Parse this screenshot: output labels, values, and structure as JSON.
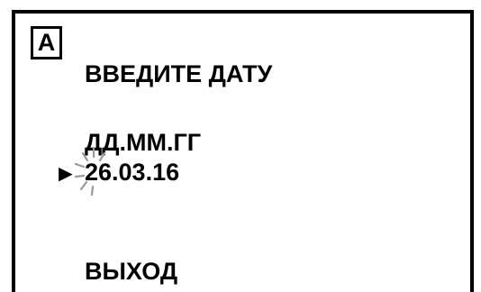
{
  "mode_badge": "A",
  "title": "ВВЕДИТЕ ДАТУ",
  "date_format": "ДД.ММ.ГГ",
  "date_value": "26.03.16",
  "cursor_symbol": "►",
  "exit_label": "ВЫХОД",
  "colors": {
    "text": "#000000",
    "background": "#ffffff",
    "blink_rays": "#999999"
  },
  "icons": {
    "cursor": "triangle-right-icon",
    "blink": "blink-indicator-icon"
  }
}
